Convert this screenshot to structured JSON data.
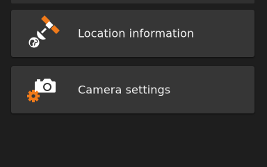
{
  "menu": {
    "items": [
      {
        "label": "Location information",
        "icon": "satellite-icon"
      },
      {
        "label": "Camera settings",
        "icon": "camera-gear-icon"
      }
    ]
  },
  "colors": {
    "background": "#1e1e1e",
    "card": "#363636",
    "accent": "#f07a1a",
    "icon": "#ffffff",
    "text": "#f2f2f2"
  }
}
